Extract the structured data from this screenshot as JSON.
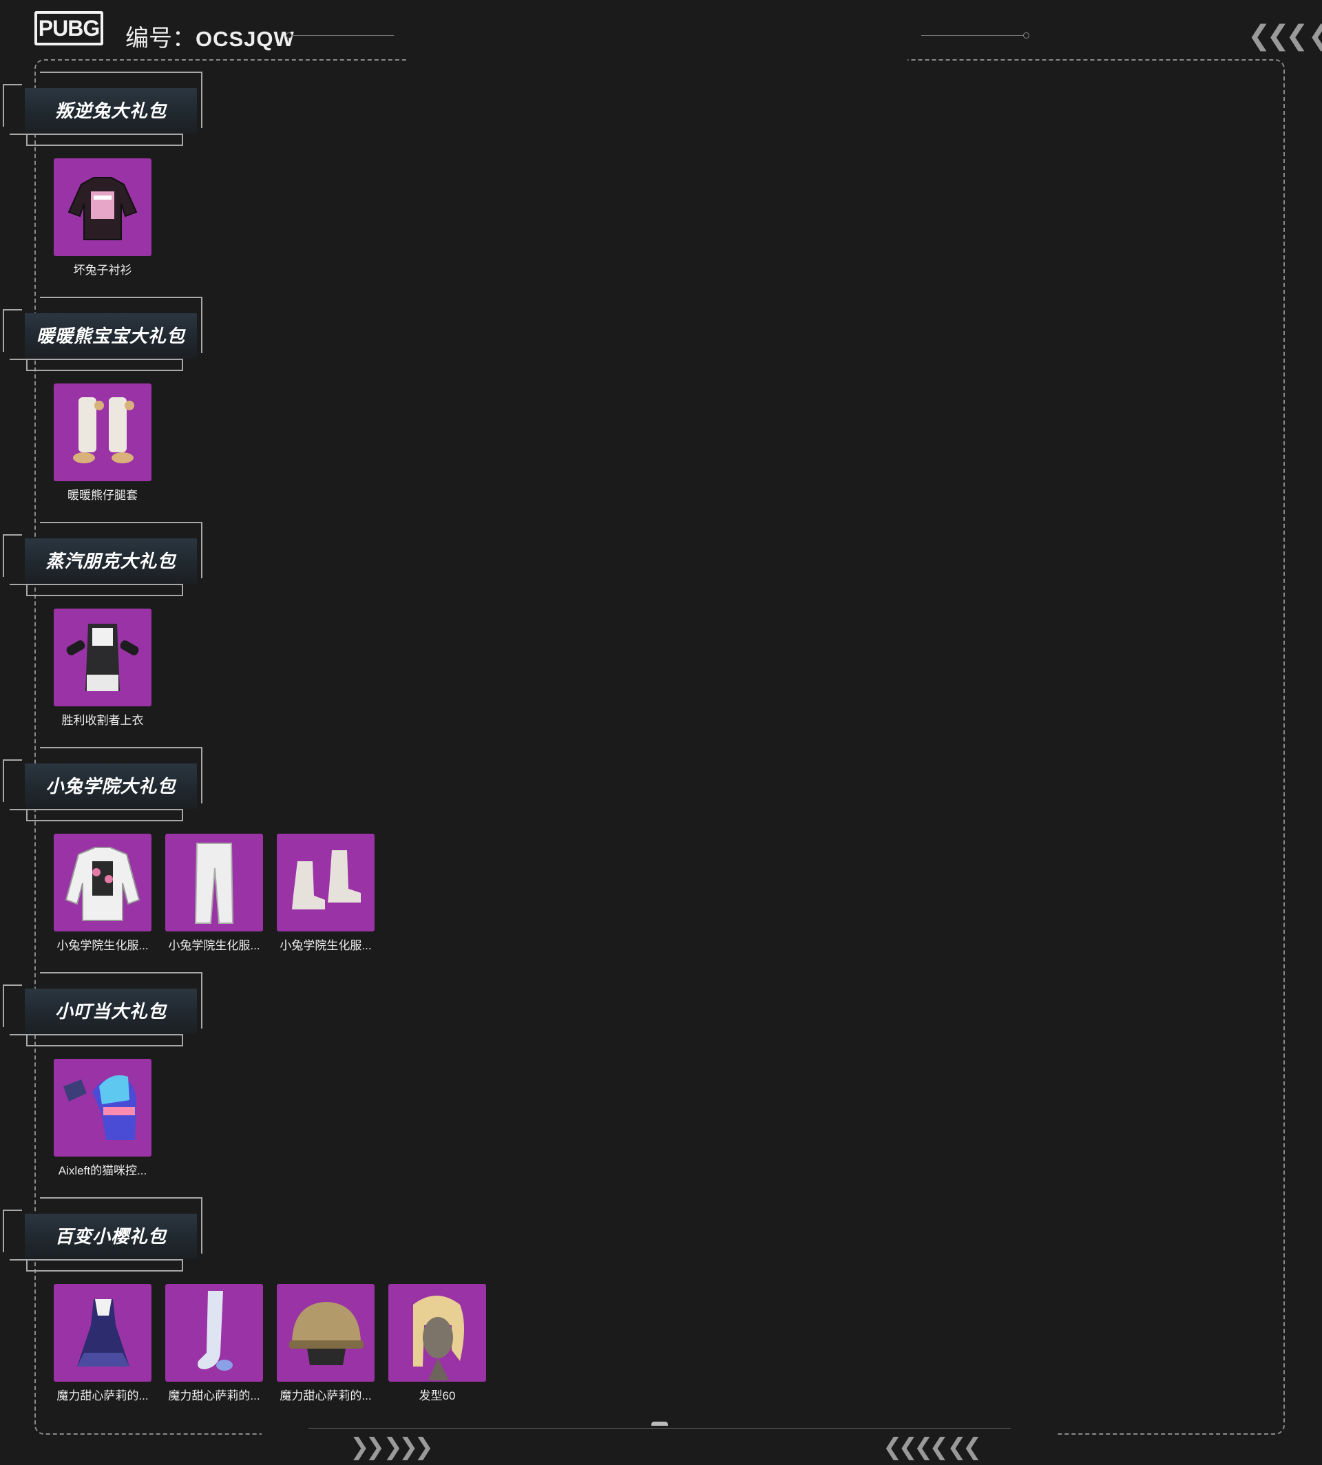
{
  "header": {
    "logo_text": "PUBG",
    "code_label": "编号：",
    "code_value": "OCSJQW"
  },
  "colors": {
    "background": "#1b1b1b",
    "tile": "#9a33a5",
    "frame_line": "#8a8a8a"
  },
  "sections": [
    {
      "title": "叛逆兔大礼包",
      "items": [
        {
          "name": "坏兔子衬衫",
          "icon": "shirt-icon"
        }
      ]
    },
    {
      "title": "暖暖熊宝宝大礼包",
      "items": [
        {
          "name": "暖暖熊仔腿套",
          "icon": "leg-warmers-icon"
        }
      ]
    },
    {
      "title": "蒸汽朋克大礼包",
      "items": [
        {
          "name": "胜利收割者上衣",
          "icon": "armor-top-icon"
        }
      ]
    },
    {
      "title": "小兔学院大礼包",
      "items": [
        {
          "name": "小兔学院生化服...",
          "icon": "jacket-icon"
        },
        {
          "name": "小兔学院生化服...",
          "icon": "pants-icon"
        },
        {
          "name": "小兔学院生化服...",
          "icon": "boots-icon"
        }
      ]
    },
    {
      "title": "小叮当大礼包",
      "items": [
        {
          "name": "Aixleft的猫咪控...",
          "icon": "gloves-icon"
        }
      ]
    },
    {
      "title": "百变小樱礼包",
      "items": [
        {
          "name": "魔力甜心萨莉的...",
          "icon": "dress-icon"
        },
        {
          "name": "魔力甜心萨莉的...",
          "icon": "stocking-icon"
        },
        {
          "name": "魔力甜心萨莉的...",
          "icon": "helmet-icon"
        },
        {
          "name": "发型60",
          "icon": "hair-icon"
        }
      ]
    }
  ]
}
